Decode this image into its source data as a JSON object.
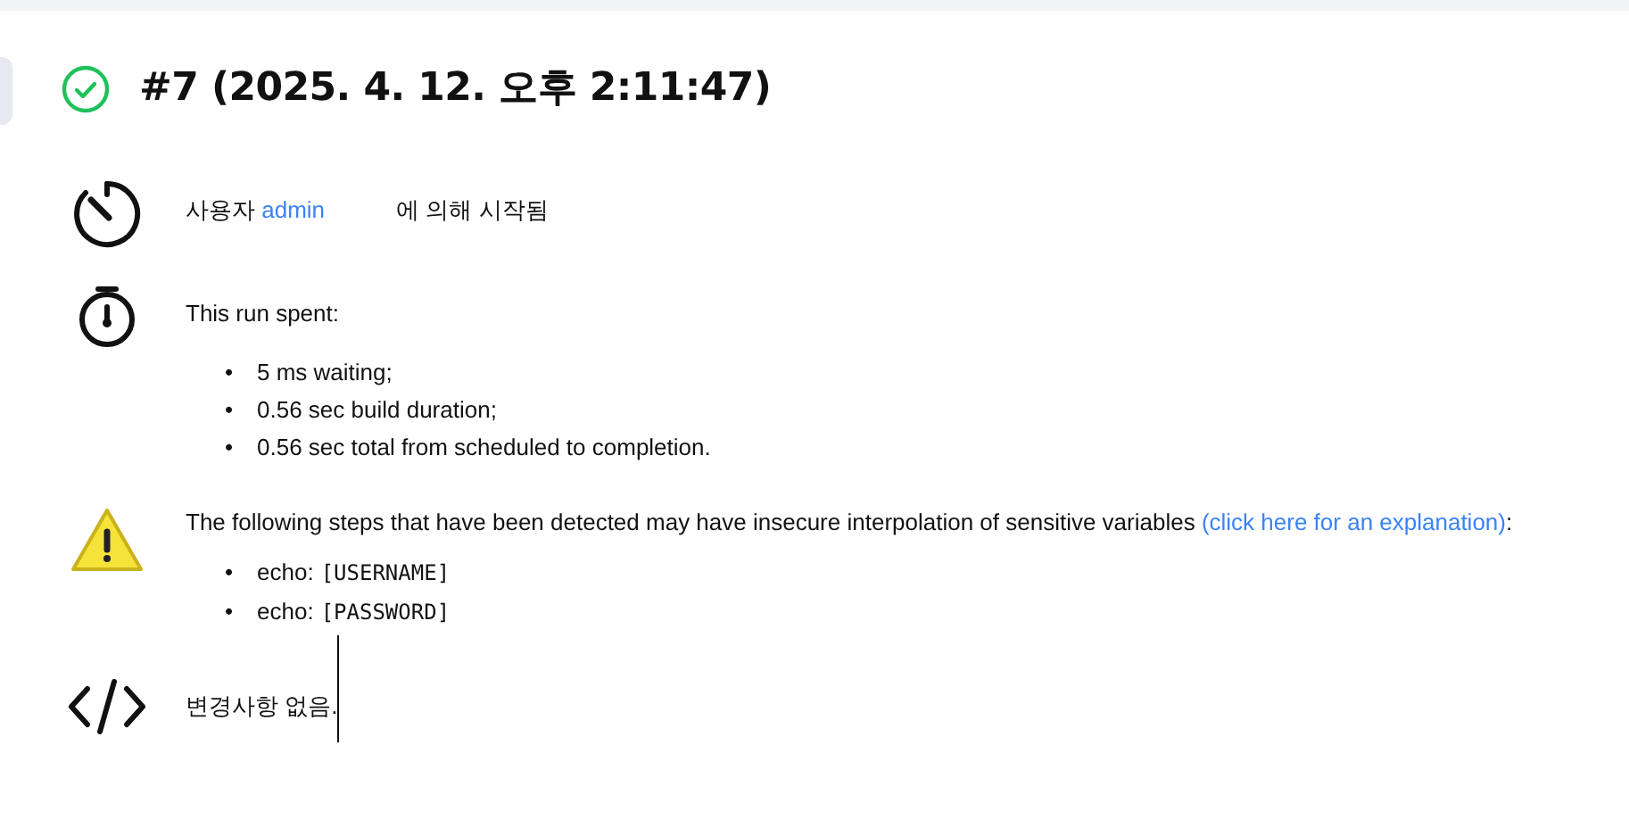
{
  "build": {
    "title": "#7 (2025. 4. 12. 오후 2:11:47)"
  },
  "sections": [
    {
      "kind": "cause",
      "before": "사용자 ",
      "link": "admin",
      "after": "에 의해 시작됨"
    },
    {
      "kind": "timing",
      "text": "This run spent:",
      "items": [
        {
          "marker": "•",
          "text": "5 ms waiting;"
        },
        {
          "marker": "•",
          "text": "0.56 sec build duration;"
        },
        {
          "marker": "•",
          "text": "0.56 sec total from scheduled to completion."
        }
      ]
    },
    {
      "kind": "warning",
      "before": "The following steps that have been detected may have insecure interpolation of sensitive variables ",
      "link": "(click here for an explanation)",
      "after": ":",
      "steps": [
        {
          "marker": "•",
          "name": "echo:",
          "args": "[USERNAME]"
        },
        {
          "marker": "•",
          "name": "echo:",
          "args": "[PASSWORD]"
        }
      ]
    },
    {
      "kind": "changes",
      "text": "변경사항 없음."
    }
  ]
}
